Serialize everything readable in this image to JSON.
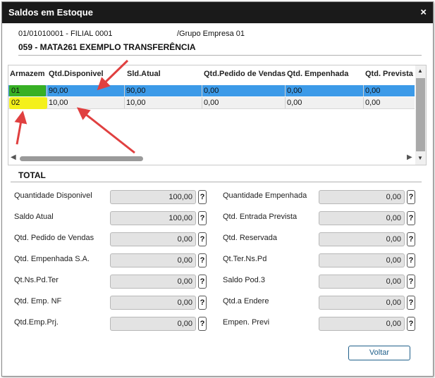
{
  "window": {
    "title": "Saldos em Estoque",
    "close_symbol": "×"
  },
  "header": {
    "filial": "01/01010001 - FILIAL 0001",
    "grupo": "/Grupo Empresa 01",
    "program": "059 - MATA261 EXEMPLO TRANSFERÊNCIA"
  },
  "grid": {
    "columns": [
      "Armazem",
      "Qtd.Disponivel",
      "Sld.Atual",
      "Qtd.Pedido de Vendas",
      "Qtd. Empenhada",
      "Qtd. Prevista"
    ],
    "rows": [
      [
        "01",
        "90,00",
        "90,00",
        "0,00",
        "0,00",
        "0,00"
      ],
      [
        "02",
        "10,00",
        "10,00",
        "0,00",
        "0,00",
        "0,00"
      ]
    ],
    "selected_row": 0
  },
  "totals": {
    "title": "TOTAL",
    "help_symbol": "?",
    "left": [
      {
        "label": "Quantidade Disponivel",
        "value": "100,00"
      },
      {
        "label": "Saldo Atual",
        "value": "100,00"
      },
      {
        "label": "Qtd. Pedido de Vendas",
        "value": "0,00"
      },
      {
        "label": "Qtd. Empenhada S.A.",
        "value": "0,00"
      },
      {
        "label": "Qt.Ns.Pd.Ter",
        "value": "0,00"
      },
      {
        "label": "Qtd. Emp. NF",
        "value": "0,00"
      },
      {
        "label": "Qtd.Emp.Prj.",
        "value": "0,00"
      }
    ],
    "right": [
      {
        "label": "Quantidade Empenhada",
        "value": "0,00"
      },
      {
        "label": "Qtd. Entrada Prevista",
        "value": "0,00"
      },
      {
        "label": "Qtd. Reservada",
        "value": "0,00"
      },
      {
        "label": "Qt.Ter.Ns.Pd",
        "value": "0,00"
      },
      {
        "label": "Saldo Pod.3",
        "value": "0,00"
      },
      {
        "label": "Qtd.a Endere",
        "value": "0,00"
      },
      {
        "label": "Empen. Previ",
        "value": "0,00"
      }
    ]
  },
  "footer": {
    "voltar_label": "Voltar"
  },
  "colors": {
    "titlebar": "#1a1a1a",
    "selected_row": "#3c9ae8",
    "highlight_green": "#37b024",
    "highlight_yellow": "#f4f01a",
    "annotation_arrow": "#e04040"
  }
}
